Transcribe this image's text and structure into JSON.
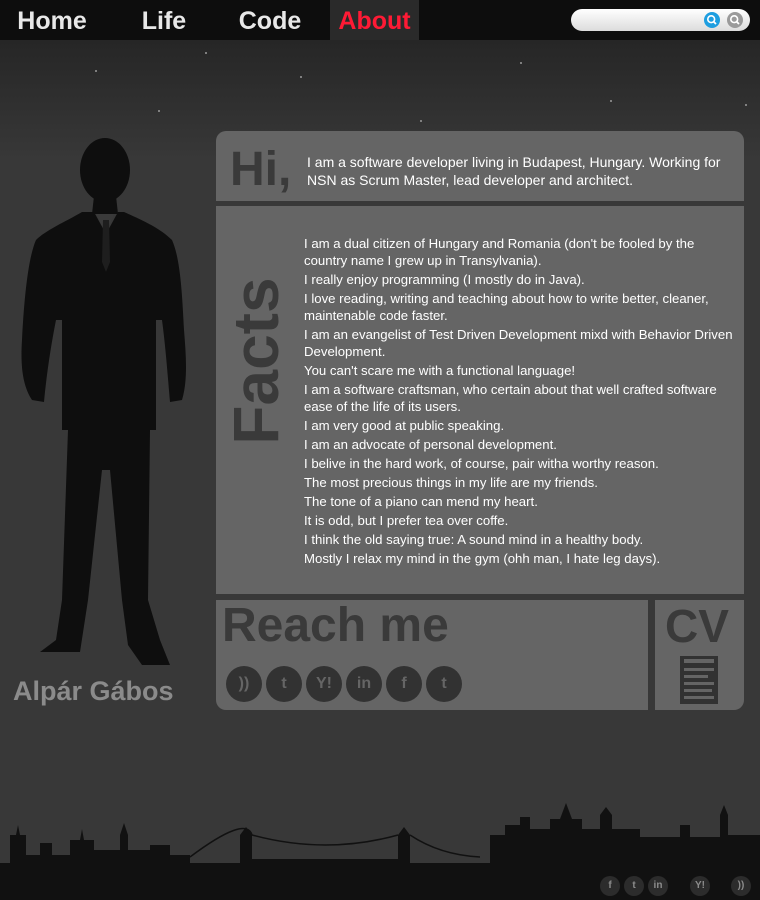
{
  "nav": {
    "items": [
      {
        "label": "Home"
      },
      {
        "label": "Life"
      },
      {
        "label": "Code"
      },
      {
        "label": "About"
      }
    ],
    "active": "About",
    "colors": {
      "active": "#ff1a35",
      "text": "#e8e8e8",
      "bar": "#0d0d0d"
    }
  },
  "search": {
    "placeholder": "",
    "value": "",
    "buttons": [
      "search-icon",
      "clear-icon"
    ]
  },
  "profile": {
    "name": "Alpár Gábos"
  },
  "intro": {
    "title": "Hi,",
    "text": "I am a software developer living in Budapest, Hungary. Working for NSN as Scrum Master, lead developer and architect."
  },
  "facts": {
    "title": "Facts",
    "items": [
      "I am a dual citizen of Hungary and Romania (don't be fooled by the country name I grew up in Transylvania).",
      "I really enjoy programming (I mostly do in Java).",
      "I love reading, writing and teaching about how to write better, cleaner, maintenable code faster.",
      "I am an evangelist of Test Driven Development mixd with Behavior Driven Development.",
      "You can't scare me with a functional language!",
      "I am a software craftsman, who certain about that well crafted software ease of the life of its users.",
      "I am very good at public speaking.",
      "I am an advocate of personal development.",
      "I belive in the hard work, of course, pair witha worthy reason.",
      "The most precious things in my life are my friends.",
      "The tone of a piano can mend my heart.",
      "It is odd, but I prefer tea over coffe.",
      "I think the old saying true: A sound mind in a healthy body.",
      "Mostly I relax my mind in the gym (ohh man, I hate leg days)."
    ]
  },
  "reach": {
    "title": "Reach me",
    "links": [
      {
        "icon": "rss-icon",
        "glyph": "))"
      },
      {
        "icon": "twitter-bird-icon",
        "glyph": "t"
      },
      {
        "icon": "yahoo-icon",
        "glyph": "Y!"
      },
      {
        "icon": "linkedin-icon",
        "glyph": "in"
      },
      {
        "icon": "facebook-icon",
        "glyph": "f"
      },
      {
        "icon": "twitter-icon",
        "glyph": "t"
      }
    ]
  },
  "cv": {
    "title": "CV",
    "icon": "document-icon"
  },
  "footer": {
    "icons": [
      {
        "icon": "facebook-icon",
        "glyph": "f"
      },
      {
        "icon": "twitter-icon",
        "glyph": "t"
      },
      {
        "icon": "linkedin-icon",
        "glyph": "in"
      },
      {
        "icon": "yahoo-icon",
        "glyph": "Y!"
      },
      {
        "icon": "rss-icon",
        "glyph": "))"
      }
    ]
  }
}
